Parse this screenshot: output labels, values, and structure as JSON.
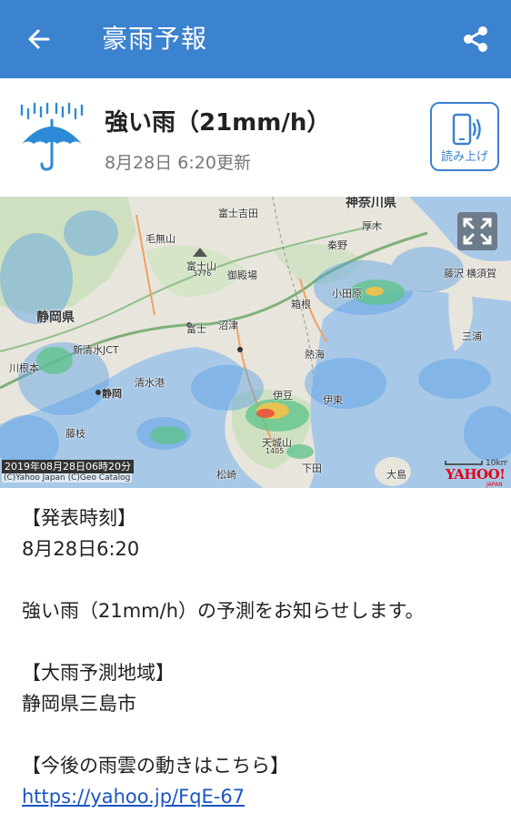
{
  "appbar": {
    "title": "豪雨予報",
    "back_icon": "arrow-left-icon",
    "share_icon": "share-icon",
    "background": "#3b82cf"
  },
  "alert": {
    "icon": "umbrella-rain-icon",
    "title": "強い雨（21mm/h）",
    "updated": "8月28日 6:20更新",
    "read_aloud_label": "読み上げ"
  },
  "map": {
    "timestamp": "2019年08月28日06時20分",
    "copyright": "(C)Yahoo Japan (C)Geo Catalog",
    "scale_label": "10km",
    "brand": "YAHOO!",
    "brand_sub": "JAPAN",
    "labels": {
      "kanagawa": "神奈川県",
      "shizuoka": "静岡県",
      "fujisan": "富士山",
      "fujisan_elev": "3776",
      "fujiyoshida": "富士吉田",
      "kenashiyama": "毛無山",
      "gotemba": "御殿場",
      "fuji": "富士",
      "numazu": "沼津",
      "atami": "熱海",
      "odawara": "小田原",
      "hakone": "箱根",
      "shizuoka_city": "静岡",
      "shimizu_port": "清水港",
      "izu": "伊豆",
      "amagi": "天城山",
      "amagi_elev": "1405",
      "matsuzaki": "松崎",
      "oshima": "大島",
      "shimoda": "下田",
      "yokosuka": "横須賀",
      "miura": "三浦",
      "fujisawa": "藤沢",
      "atsugi": "厚木",
      "hadano": "秦野",
      "kawane": "川根本",
      "fujieda": "藤枝",
      "jct": "新清水JCT",
      "ito": "伊東"
    }
  },
  "body": {
    "announce_header": "【発表時刻】",
    "announce_time": "8月28日6:20",
    "message": "強い雨（21mm/h）の予測をお知らせします。",
    "area_header": "【大雨予測地域】",
    "area": "静岡県三島市",
    "movement_header": "【今後の雨雲の動きはこちら】",
    "link": "https://yahoo.jp/FqE-67"
  }
}
